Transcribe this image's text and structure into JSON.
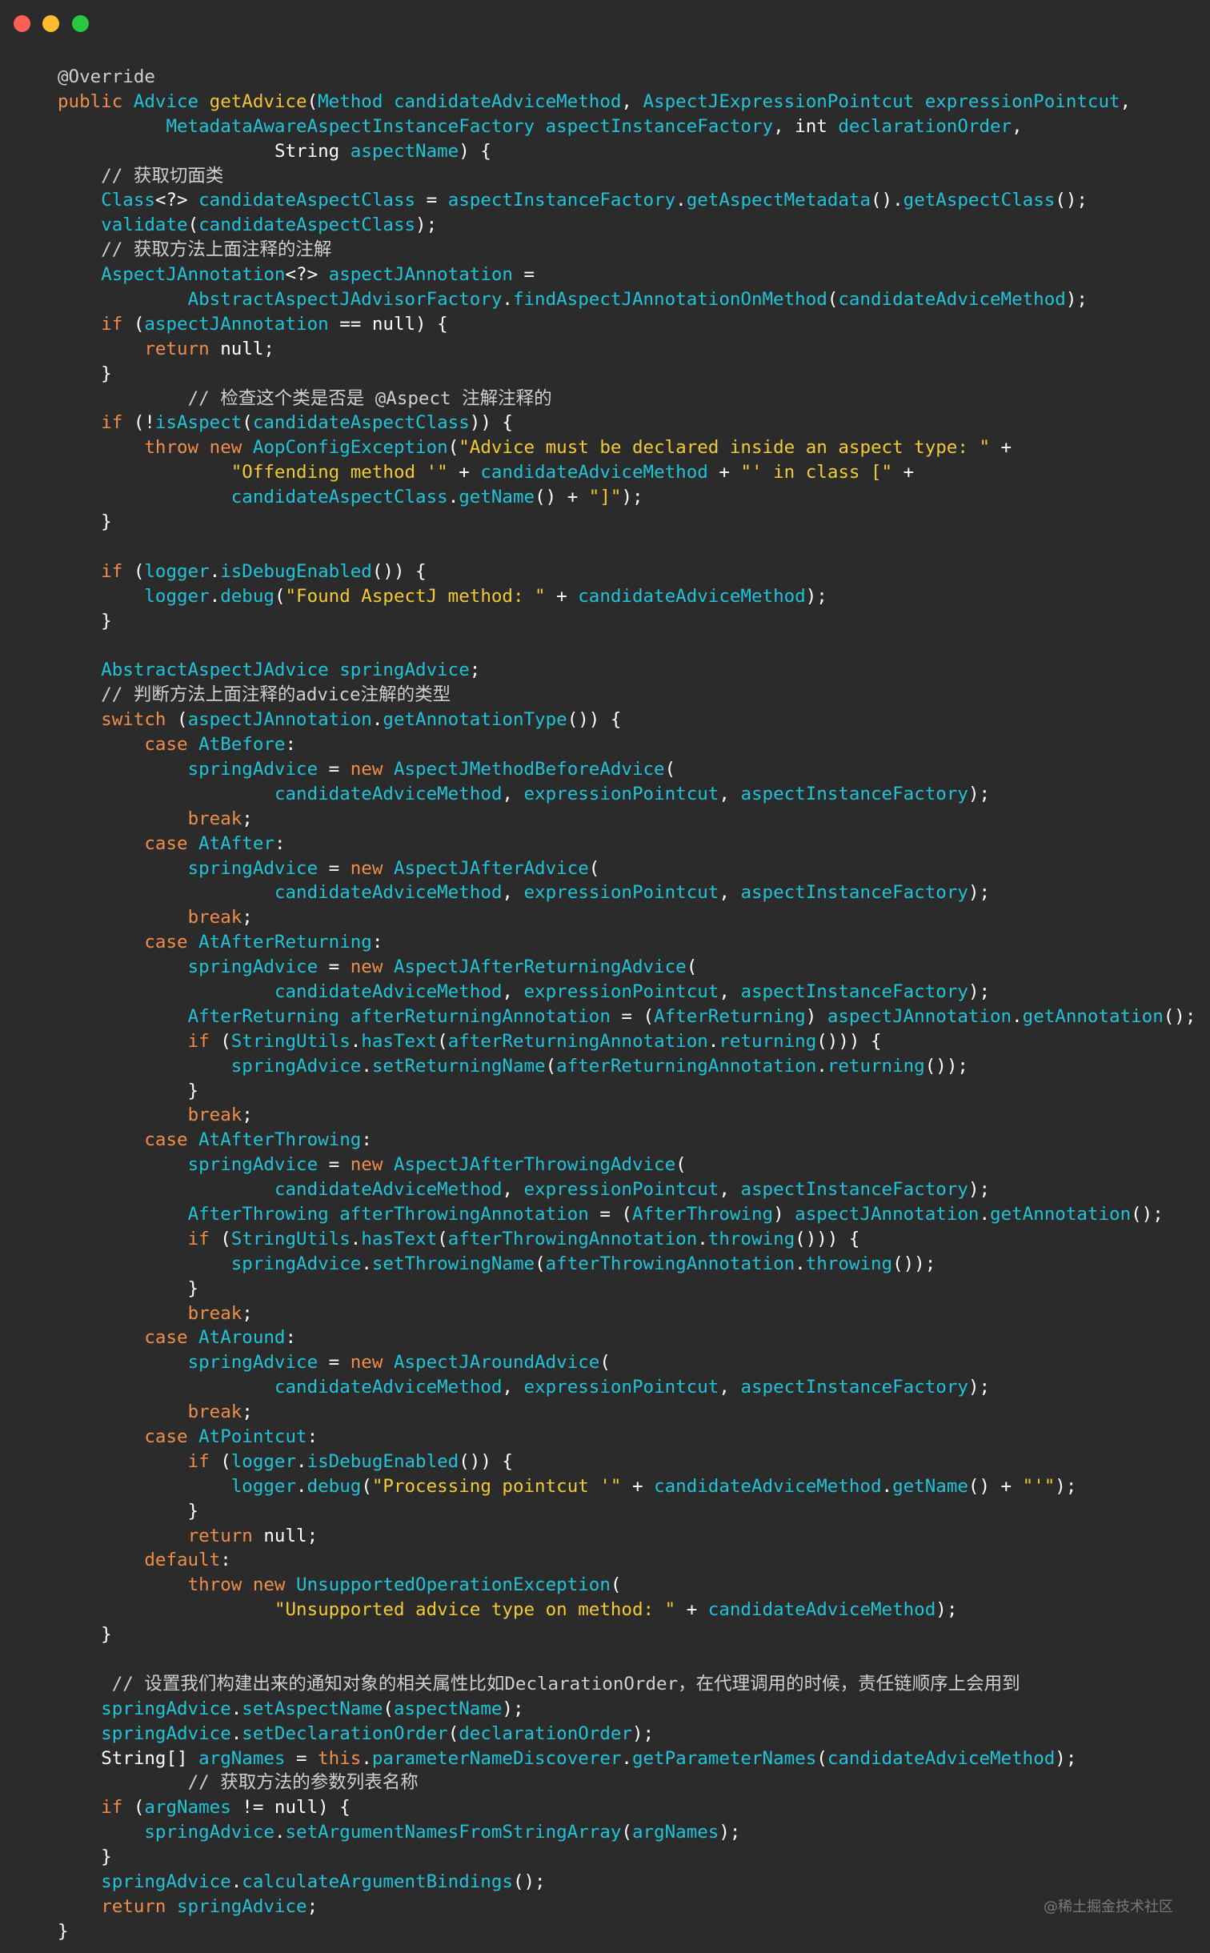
{
  "window": {
    "controls": [
      "close",
      "minimize",
      "zoom"
    ]
  },
  "watermark": "@稀土掘金技术社区",
  "code_lines": [
    [
      [
        "a",
        "@Override"
      ]
    ],
    [
      [
        "k",
        "public "
      ],
      [
        "t",
        "Advice "
      ],
      [
        "f",
        "getAdvice"
      ],
      [
        "p",
        "("
      ],
      [
        "t",
        "Method candidateAdviceMethod"
      ],
      [
        "p",
        ", "
      ],
      [
        "t",
        "AspectJExpressionPointcut expressionPointcut"
      ],
      [
        "p",
        ","
      ]
    ],
    [
      [
        "p",
        "          "
      ],
      [
        "t",
        "MetadataAwareAspectInstanceFactory aspectInstanceFactory"
      ],
      [
        "p",
        ", "
      ],
      [
        "e",
        "int "
      ],
      [
        "t",
        "declarationOrder"
      ],
      [
        "p",
        ","
      ]
    ],
    [
      [
        "p",
        "                    "
      ],
      [
        "e",
        "String "
      ],
      [
        "t",
        "aspectName"
      ],
      [
        "p",
        ") {"
      ]
    ],
    [
      [
        "p",
        "    "
      ],
      [
        "c",
        "// 获取切面类"
      ]
    ],
    [
      [
        "p",
        "    "
      ],
      [
        "t",
        "Class"
      ],
      [
        "p",
        "<?> "
      ],
      [
        "t",
        "candidateAspectClass"
      ],
      [
        "p",
        " = "
      ],
      [
        "t",
        "aspectInstanceFactory"
      ],
      [
        "p",
        "."
      ],
      [
        "t",
        "getAspectMetadata"
      ],
      [
        "p",
        "()."
      ],
      [
        "t",
        "getAspectClass"
      ],
      [
        "p",
        "();"
      ]
    ],
    [
      [
        "p",
        "    "
      ],
      [
        "t",
        "validate"
      ],
      [
        "p",
        "("
      ],
      [
        "t",
        "candidateAspectClass"
      ],
      [
        "p",
        ");"
      ]
    ],
    [
      [
        "p",
        "    "
      ],
      [
        "c",
        "// 获取方法上面注释的注解"
      ]
    ],
    [
      [
        "p",
        "    "
      ],
      [
        "t",
        "AspectJAnnotation"
      ],
      [
        "p",
        "<?> "
      ],
      [
        "t",
        "aspectJAnnotation"
      ],
      [
        "p",
        " ="
      ]
    ],
    [
      [
        "p",
        "            "
      ],
      [
        "t",
        "AbstractAspectJAdvisorFactory"
      ],
      [
        "p",
        "."
      ],
      [
        "t",
        "findAspectJAnnotationOnMethod"
      ],
      [
        "p",
        "("
      ],
      [
        "t",
        "candidateAdviceMethod"
      ],
      [
        "p",
        ");"
      ]
    ],
    [
      [
        "p",
        "    "
      ],
      [
        "k",
        "if "
      ],
      [
        "p",
        "("
      ],
      [
        "t",
        "aspectJAnnotation"
      ],
      [
        "p",
        " == null) {"
      ]
    ],
    [
      [
        "p",
        "        "
      ],
      [
        "k",
        "return "
      ],
      [
        "p",
        "null;"
      ]
    ],
    [
      [
        "p",
        "    }"
      ]
    ],
    [
      [
        "p",
        "            "
      ],
      [
        "c",
        "// 检查这个类是否是 @Aspect 注解注释的"
      ]
    ],
    [
      [
        "p",
        "    "
      ],
      [
        "k",
        "if "
      ],
      [
        "p",
        "(!"
      ],
      [
        "t",
        "isAspect"
      ],
      [
        "p",
        "("
      ],
      [
        "t",
        "candidateAspectClass"
      ],
      [
        "p",
        ")) {"
      ]
    ],
    [
      [
        "p",
        "        "
      ],
      [
        "k",
        "throw new "
      ],
      [
        "t",
        "AopConfigException"
      ],
      [
        "p",
        "("
      ],
      [
        "s",
        "\"Advice must be declared inside an aspect type: \""
      ],
      [
        "p",
        " +"
      ]
    ],
    [
      [
        "p",
        "                "
      ],
      [
        "s",
        "\"Offending method '\""
      ],
      [
        "p",
        " + "
      ],
      [
        "t",
        "candidateAdviceMethod"
      ],
      [
        "p",
        " + "
      ],
      [
        "s",
        "\"' in class [\""
      ],
      [
        "p",
        " +"
      ]
    ],
    [
      [
        "p",
        "                "
      ],
      [
        "t",
        "candidateAspectClass"
      ],
      [
        "p",
        "."
      ],
      [
        "t",
        "getName"
      ],
      [
        "p",
        "() + "
      ],
      [
        "s",
        "\"]\""
      ],
      [
        "p",
        ");"
      ]
    ],
    [
      [
        "p",
        "    }"
      ]
    ],
    [
      [
        "p",
        ""
      ]
    ],
    [
      [
        "p",
        "    "
      ],
      [
        "k",
        "if "
      ],
      [
        "p",
        "("
      ],
      [
        "t",
        "logger"
      ],
      [
        "p",
        "."
      ],
      [
        "t",
        "isDebugEnabled"
      ],
      [
        "p",
        "()) {"
      ]
    ],
    [
      [
        "p",
        "        "
      ],
      [
        "t",
        "logger"
      ],
      [
        "p",
        "."
      ],
      [
        "t",
        "debug"
      ],
      [
        "p",
        "("
      ],
      [
        "s",
        "\"Found AspectJ method: \""
      ],
      [
        "p",
        " + "
      ],
      [
        "t",
        "candidateAdviceMethod"
      ],
      [
        "p",
        ");"
      ]
    ],
    [
      [
        "p",
        "    }"
      ]
    ],
    [
      [
        "p",
        ""
      ]
    ],
    [
      [
        "p",
        "    "
      ],
      [
        "t",
        "AbstractAspectJAdvice springAdvice"
      ],
      [
        "p",
        ";"
      ]
    ],
    [
      [
        "p",
        "    "
      ],
      [
        "c",
        "// 判断方法上面注释的advice注解的类型"
      ]
    ],
    [
      [
        "p",
        "    "
      ],
      [
        "k",
        "switch "
      ],
      [
        "p",
        "("
      ],
      [
        "t",
        "aspectJAnnotation"
      ],
      [
        "p",
        "."
      ],
      [
        "t",
        "getAnnotationType"
      ],
      [
        "p",
        "()) {"
      ]
    ],
    [
      [
        "p",
        "        "
      ],
      [
        "k",
        "case "
      ],
      [
        "t",
        "AtBefore"
      ],
      [
        "p",
        ":"
      ]
    ],
    [
      [
        "p",
        "            "
      ],
      [
        "t",
        "springAdvice"
      ],
      [
        "p",
        " = "
      ],
      [
        "k",
        "new "
      ],
      [
        "t",
        "AspectJMethodBeforeAdvice"
      ],
      [
        "p",
        "("
      ]
    ],
    [
      [
        "p",
        "                    "
      ],
      [
        "t",
        "candidateAdviceMethod"
      ],
      [
        "p",
        ", "
      ],
      [
        "t",
        "expressionPointcut"
      ],
      [
        "p",
        ", "
      ],
      [
        "t",
        "aspectInstanceFactory"
      ],
      [
        "p",
        ");"
      ]
    ],
    [
      [
        "p",
        "            "
      ],
      [
        "k",
        "break"
      ],
      [
        "p",
        ";"
      ]
    ],
    [
      [
        "p",
        "        "
      ],
      [
        "k",
        "case "
      ],
      [
        "t",
        "AtAfter"
      ],
      [
        "p",
        ":"
      ]
    ],
    [
      [
        "p",
        "            "
      ],
      [
        "t",
        "springAdvice"
      ],
      [
        "p",
        " = "
      ],
      [
        "k",
        "new "
      ],
      [
        "t",
        "AspectJAfterAdvice"
      ],
      [
        "p",
        "("
      ]
    ],
    [
      [
        "p",
        "                    "
      ],
      [
        "t",
        "candidateAdviceMethod"
      ],
      [
        "p",
        ", "
      ],
      [
        "t",
        "expressionPointcut"
      ],
      [
        "p",
        ", "
      ],
      [
        "t",
        "aspectInstanceFactory"
      ],
      [
        "p",
        ");"
      ]
    ],
    [
      [
        "p",
        "            "
      ],
      [
        "k",
        "break"
      ],
      [
        "p",
        ";"
      ]
    ],
    [
      [
        "p",
        "        "
      ],
      [
        "k",
        "case "
      ],
      [
        "t",
        "AtAfterReturning"
      ],
      [
        "p",
        ":"
      ]
    ],
    [
      [
        "p",
        "            "
      ],
      [
        "t",
        "springAdvice"
      ],
      [
        "p",
        " = "
      ],
      [
        "k",
        "new "
      ],
      [
        "t",
        "AspectJAfterReturningAdvice"
      ],
      [
        "p",
        "("
      ]
    ],
    [
      [
        "p",
        "                    "
      ],
      [
        "t",
        "candidateAdviceMethod"
      ],
      [
        "p",
        ", "
      ],
      [
        "t",
        "expressionPointcut"
      ],
      [
        "p",
        ", "
      ],
      [
        "t",
        "aspectInstanceFactory"
      ],
      [
        "p",
        ");"
      ]
    ],
    [
      [
        "p",
        "            "
      ],
      [
        "t",
        "AfterReturning afterReturningAnnotation"
      ],
      [
        "p",
        " = ("
      ],
      [
        "t",
        "AfterReturning"
      ],
      [
        "p",
        ") "
      ],
      [
        "t",
        "aspectJAnnotation"
      ],
      [
        "p",
        "."
      ],
      [
        "t",
        "getAnnotation"
      ],
      [
        "p",
        "();"
      ]
    ],
    [
      [
        "p",
        "            "
      ],
      [
        "k",
        "if "
      ],
      [
        "p",
        "("
      ],
      [
        "t",
        "StringUtils"
      ],
      [
        "p",
        "."
      ],
      [
        "t",
        "hasText"
      ],
      [
        "p",
        "("
      ],
      [
        "t",
        "afterReturningAnnotation"
      ],
      [
        "p",
        "."
      ],
      [
        "t",
        "returning"
      ],
      [
        "p",
        "())) {"
      ]
    ],
    [
      [
        "p",
        "                "
      ],
      [
        "t",
        "springAdvice"
      ],
      [
        "p",
        "."
      ],
      [
        "t",
        "setReturningName"
      ],
      [
        "p",
        "("
      ],
      [
        "t",
        "afterReturningAnnotation"
      ],
      [
        "p",
        "."
      ],
      [
        "t",
        "returning"
      ],
      [
        "p",
        "());"
      ]
    ],
    [
      [
        "p",
        "            }"
      ]
    ],
    [
      [
        "p",
        "            "
      ],
      [
        "k",
        "break"
      ],
      [
        "p",
        ";"
      ]
    ],
    [
      [
        "p",
        "        "
      ],
      [
        "k",
        "case "
      ],
      [
        "t",
        "AtAfterThrowing"
      ],
      [
        "p",
        ":"
      ]
    ],
    [
      [
        "p",
        "            "
      ],
      [
        "t",
        "springAdvice"
      ],
      [
        "p",
        " = "
      ],
      [
        "k",
        "new "
      ],
      [
        "t",
        "AspectJAfterThrowingAdvice"
      ],
      [
        "p",
        "("
      ]
    ],
    [
      [
        "p",
        "                    "
      ],
      [
        "t",
        "candidateAdviceMethod"
      ],
      [
        "p",
        ", "
      ],
      [
        "t",
        "expressionPointcut"
      ],
      [
        "p",
        ", "
      ],
      [
        "t",
        "aspectInstanceFactory"
      ],
      [
        "p",
        ");"
      ]
    ],
    [
      [
        "p",
        "            "
      ],
      [
        "t",
        "AfterThrowing afterThrowingAnnotation"
      ],
      [
        "p",
        " = ("
      ],
      [
        "t",
        "AfterThrowing"
      ],
      [
        "p",
        ") "
      ],
      [
        "t",
        "aspectJAnnotation"
      ],
      [
        "p",
        "."
      ],
      [
        "t",
        "getAnnotation"
      ],
      [
        "p",
        "();"
      ]
    ],
    [
      [
        "p",
        "            "
      ],
      [
        "k",
        "if "
      ],
      [
        "p",
        "("
      ],
      [
        "t",
        "StringUtils"
      ],
      [
        "p",
        "."
      ],
      [
        "t",
        "hasText"
      ],
      [
        "p",
        "("
      ],
      [
        "t",
        "afterThrowingAnnotation"
      ],
      [
        "p",
        "."
      ],
      [
        "t",
        "throwing"
      ],
      [
        "p",
        "())) {"
      ]
    ],
    [
      [
        "p",
        "                "
      ],
      [
        "t",
        "springAdvice"
      ],
      [
        "p",
        "."
      ],
      [
        "t",
        "setThrowingName"
      ],
      [
        "p",
        "("
      ],
      [
        "t",
        "afterThrowingAnnotation"
      ],
      [
        "p",
        "."
      ],
      [
        "t",
        "throwing"
      ],
      [
        "p",
        "());"
      ]
    ],
    [
      [
        "p",
        "            }"
      ]
    ],
    [
      [
        "p",
        "            "
      ],
      [
        "k",
        "break"
      ],
      [
        "p",
        ";"
      ]
    ],
    [
      [
        "p",
        "        "
      ],
      [
        "k",
        "case "
      ],
      [
        "t",
        "AtAround"
      ],
      [
        "p",
        ":"
      ]
    ],
    [
      [
        "p",
        "            "
      ],
      [
        "t",
        "springAdvice"
      ],
      [
        "p",
        " = "
      ],
      [
        "k",
        "new "
      ],
      [
        "t",
        "AspectJAroundAdvice"
      ],
      [
        "p",
        "("
      ]
    ],
    [
      [
        "p",
        "                    "
      ],
      [
        "t",
        "candidateAdviceMethod"
      ],
      [
        "p",
        ", "
      ],
      [
        "t",
        "expressionPointcut"
      ],
      [
        "p",
        ", "
      ],
      [
        "t",
        "aspectInstanceFactory"
      ],
      [
        "p",
        ");"
      ]
    ],
    [
      [
        "p",
        "            "
      ],
      [
        "k",
        "break"
      ],
      [
        "p",
        ";"
      ]
    ],
    [
      [
        "p",
        "        "
      ],
      [
        "k",
        "case "
      ],
      [
        "t",
        "AtPointcut"
      ],
      [
        "p",
        ":"
      ]
    ],
    [
      [
        "p",
        "            "
      ],
      [
        "k",
        "if "
      ],
      [
        "p",
        "("
      ],
      [
        "t",
        "logger"
      ],
      [
        "p",
        "."
      ],
      [
        "t",
        "isDebugEnabled"
      ],
      [
        "p",
        "()) {"
      ]
    ],
    [
      [
        "p",
        "                "
      ],
      [
        "t",
        "logger"
      ],
      [
        "p",
        "."
      ],
      [
        "t",
        "debug"
      ],
      [
        "p",
        "("
      ],
      [
        "s",
        "\"Processing pointcut '\""
      ],
      [
        "p",
        " + "
      ],
      [
        "t",
        "candidateAdviceMethod"
      ],
      [
        "p",
        "."
      ],
      [
        "t",
        "getName"
      ],
      [
        "p",
        "() + "
      ],
      [
        "s",
        "\"'\""
      ],
      [
        "p",
        ");"
      ]
    ],
    [
      [
        "p",
        "            }"
      ]
    ],
    [
      [
        "p",
        "            "
      ],
      [
        "k",
        "return "
      ],
      [
        "p",
        "null;"
      ]
    ],
    [
      [
        "p",
        "        "
      ],
      [
        "k",
        "default"
      ],
      [
        "p",
        ":"
      ]
    ],
    [
      [
        "p",
        "            "
      ],
      [
        "k",
        "throw new "
      ],
      [
        "t",
        "UnsupportedOperationException"
      ],
      [
        "p",
        "("
      ]
    ],
    [
      [
        "p",
        "                    "
      ],
      [
        "s",
        "\"Unsupported advice type on method: \""
      ],
      [
        "p",
        " + "
      ],
      [
        "t",
        "candidateAdviceMethod"
      ],
      [
        "p",
        ");"
      ]
    ],
    [
      [
        "p",
        "    }"
      ]
    ],
    [
      [
        "p",
        ""
      ]
    ],
    [
      [
        "p",
        "     "
      ],
      [
        "c",
        "// 设置我们构建出来的通知对象的相关属性比如DeclarationOrder，在代理调用的时候，责任链顺序上会用到"
      ]
    ],
    [
      [
        "p",
        "    "
      ],
      [
        "t",
        "springAdvice"
      ],
      [
        "p",
        "."
      ],
      [
        "t",
        "setAspectName"
      ],
      [
        "p",
        "("
      ],
      [
        "t",
        "aspectName"
      ],
      [
        "p",
        ");"
      ]
    ],
    [
      [
        "p",
        "    "
      ],
      [
        "t",
        "springAdvice"
      ],
      [
        "p",
        "."
      ],
      [
        "t",
        "setDeclarationOrder"
      ],
      [
        "p",
        "("
      ],
      [
        "t",
        "declarationOrder"
      ],
      [
        "p",
        ");"
      ]
    ],
    [
      [
        "p",
        "    "
      ],
      [
        "e",
        "String[] "
      ],
      [
        "t",
        "argNames"
      ],
      [
        "p",
        " = "
      ],
      [
        "k",
        "this"
      ],
      [
        "p",
        "."
      ],
      [
        "t",
        "parameterNameDiscoverer"
      ],
      [
        "p",
        "."
      ],
      [
        "t",
        "getParameterNames"
      ],
      [
        "p",
        "("
      ],
      [
        "t",
        "candidateAdviceMethod"
      ],
      [
        "p",
        ");"
      ]
    ],
    [
      [
        "p",
        "            "
      ],
      [
        "c",
        "// 获取方法的参数列表名称"
      ]
    ],
    [
      [
        "p",
        "    "
      ],
      [
        "k",
        "if "
      ],
      [
        "p",
        "("
      ],
      [
        "t",
        "argNames"
      ],
      [
        "p",
        " != null) {"
      ]
    ],
    [
      [
        "p",
        "        "
      ],
      [
        "t",
        "springAdvice"
      ],
      [
        "p",
        "."
      ],
      [
        "t",
        "setArgumentNamesFromStringArray"
      ],
      [
        "p",
        "("
      ],
      [
        "t",
        "argNames"
      ],
      [
        "p",
        ");"
      ]
    ],
    [
      [
        "p",
        "    }"
      ]
    ],
    [
      [
        "p",
        "    "
      ],
      [
        "t",
        "springAdvice"
      ],
      [
        "p",
        "."
      ],
      [
        "t",
        "calculateArgumentBindings"
      ],
      [
        "p",
        "();"
      ]
    ],
    [
      [
        "p",
        "    "
      ],
      [
        "k",
        "return "
      ],
      [
        "t",
        "springAdvice"
      ],
      [
        "p",
        ";"
      ]
    ],
    [
      [
        "p",
        "}"
      ]
    ]
  ]
}
